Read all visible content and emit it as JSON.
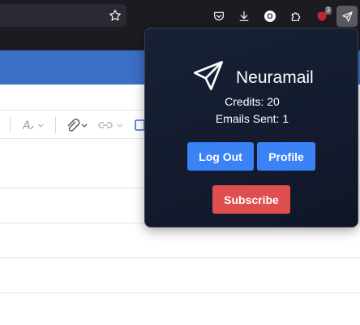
{
  "browser": {
    "extension_badge": "3",
    "profile_initial": "O"
  },
  "popup": {
    "brand_name": "Neuramail",
    "credits_text": "Credits: 20",
    "emails_sent_text": "Emails Sent: 1",
    "logout_label": "Log Out",
    "profile_label": "Profile",
    "subscribe_label": "Subscribe"
  },
  "colors": {
    "popup_bg": "#141b2e",
    "primary_button": "#3b82f6",
    "subscribe_button": "#e04f4f",
    "page_header": "#3b6fc4"
  }
}
